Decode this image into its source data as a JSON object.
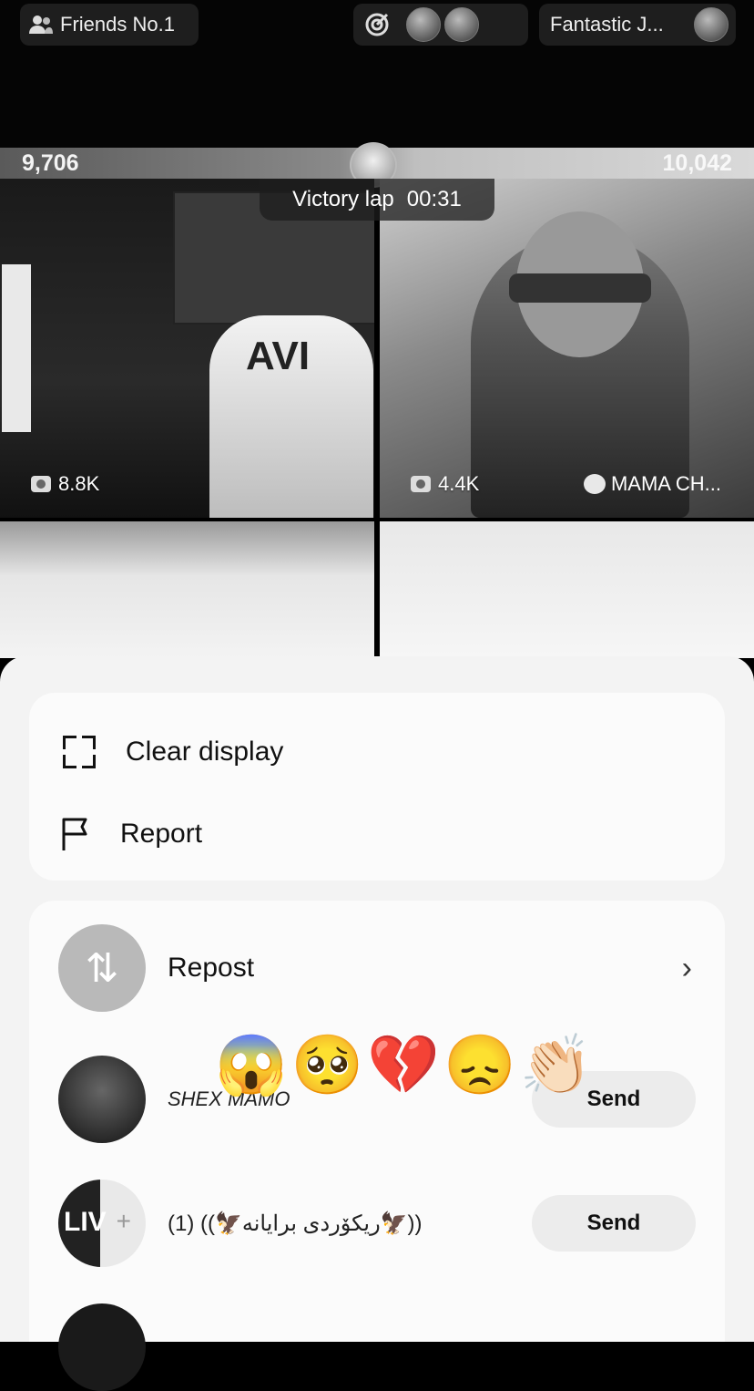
{
  "top_bar": {
    "friends_label": "Friends No.1",
    "host_label": "Fantastic J..."
  },
  "battle": {
    "score_left": "9,706",
    "score_right": "10,042",
    "status_label": "Victory lap",
    "timer": "00:31"
  },
  "tiles": [
    {
      "viewers": "8.8K",
      "chair_logo": "AVI"
    },
    {
      "viewers": "4.4K",
      "name": "MAMA CH..."
    }
  ],
  "sheet": {
    "clear_display": "Clear display",
    "report": "Report",
    "repost": "Repost",
    "emojis": "😱🥺💔😞👏🏻",
    "users": [
      {
        "name": "SHEX MAMO",
        "send_label": "Send"
      },
      {
        "name": "(1) ((🦅ریکۆردی برایانه🦅))",
        "send_label": "Send",
        "avatar_text": "LIV"
      }
    ]
  },
  "icons": [
    "people-icon",
    "target-icon",
    "camera-icon",
    "paw-icon",
    "fullscreen-icon",
    "flag-icon",
    "repost-icon",
    "chevron-right-icon",
    "plus-icon"
  ]
}
